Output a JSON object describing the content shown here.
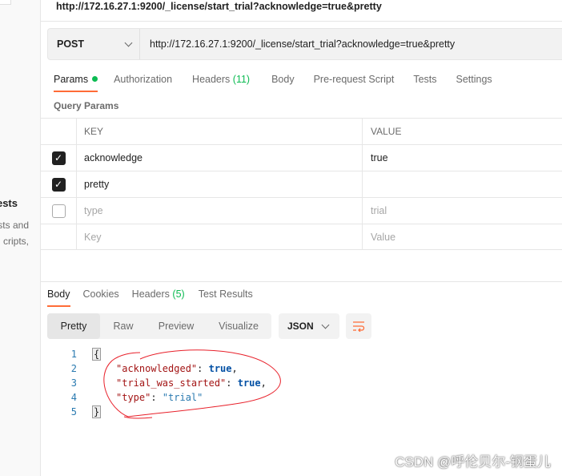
{
  "sidebar": {
    "title": "ests",
    "lines": [
      "sts and",
      "cripts,"
    ]
  },
  "top_url": "http://172.16.27.1:9200/_license/start_trial?acknowledge=true&pretty",
  "request": {
    "method": "POST",
    "url": "http://172.16.27.1:9200/_license/start_trial?acknowledge=true&pretty"
  },
  "request_tabs": [
    {
      "label": "Params",
      "active": true,
      "dot": true
    },
    {
      "label": "Authorization"
    },
    {
      "label": "Headers",
      "count": "(11)"
    },
    {
      "label": "Body"
    },
    {
      "label": "Pre-request Script"
    },
    {
      "label": "Tests"
    },
    {
      "label": "Settings"
    }
  ],
  "query_params": {
    "title": "Query Params",
    "headers": [
      "KEY",
      "VALUE"
    ],
    "rows": [
      {
        "checked": true,
        "key": "acknowledge",
        "value": "true"
      },
      {
        "checked": true,
        "key": "pretty",
        "value": ""
      },
      {
        "checked": false,
        "key": "type",
        "value": "trial",
        "disabled": true
      }
    ],
    "placeholder": {
      "key": "Key",
      "value": "Value"
    }
  },
  "response_tabs": [
    {
      "label": "Body",
      "active": true
    },
    {
      "label": "Cookies"
    },
    {
      "label": "Headers",
      "count": "(5)"
    },
    {
      "label": "Test Results"
    }
  ],
  "view_modes": [
    "Pretty",
    "Raw",
    "Preview",
    "Visualize"
  ],
  "selected_view": "Pretty",
  "format": "JSON",
  "code": {
    "lines": [
      "1",
      "2",
      "3",
      "4",
      "5"
    ],
    "open": "{",
    "close": "}",
    "entries": [
      {
        "key": "\"acknowledged\"",
        "value": "true",
        "sep": ","
      },
      {
        "key": "\"trial_was_started\"",
        "value": "true",
        "sep": ","
      },
      {
        "key": "\"type\"",
        "value": "\"trial\"",
        "sep": ""
      }
    ]
  },
  "colors": {
    "accent": "#ff6c37",
    "green": "#0cbb52",
    "annotation": "#e8202a"
  },
  "watermark": "CSDN @呼伦贝尔-钢蛋儿"
}
